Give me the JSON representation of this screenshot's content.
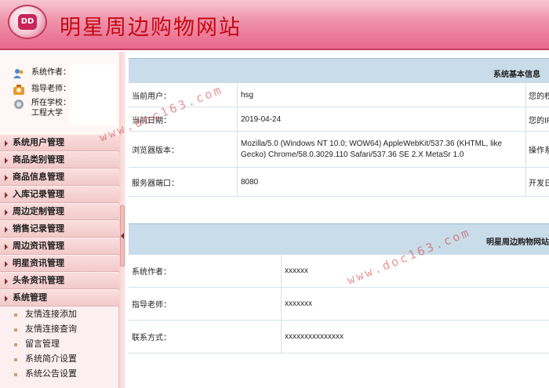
{
  "header": {
    "logo_text": "DD",
    "title": "明星周边购物网站"
  },
  "user_info": {
    "author_label": "系统作者：",
    "teacher_label": "指导老师：",
    "school_label": "所在学校：",
    "school_value_tail": "工程大学"
  },
  "sidebar": {
    "menu": [
      "系统用户管理",
      "商品类别管理",
      "商品信息管理",
      "入库记录管理",
      "周边定制管理",
      "销售记录管理",
      "周边资讯管理",
      "明星资讯管理",
      "头条资讯管理",
      "系统管理"
    ],
    "submenu": [
      "友情连接添加",
      "友情连接查询",
      "留言管理",
      "系统简介设置",
      "系统公告设置"
    ]
  },
  "system_info": {
    "title": "系统基本信息",
    "rows": [
      {
        "label": "当前用户：",
        "value": "hsg",
        "extra": "您的权"
      },
      {
        "label": "当前日期：",
        "value": "2019-04-24",
        "extra": "您的IP"
      },
      {
        "label": "浏览器版本：",
        "value": "Mozilla/5.0 (Windows NT 10.0; WOW64) AppleWebKit/537.36 (KHTML, like Gecko) Chrome/58.0.3029.110 Safari/537.36 SE 2.X MetaSr 1.0",
        "extra": "操作系"
      },
      {
        "label": "服务器端口：",
        "value": "8080",
        "extra": "开发日"
      }
    ]
  },
  "site_info": {
    "title": "明星周边购物网站",
    "rows": [
      {
        "label": "系统作者：",
        "value": "xxxxxx"
      },
      {
        "label": "指导老师：",
        "value": "xxxxxxx"
      },
      {
        "label": "联系方式：",
        "value": "xxxxxxxxxxxxxxx"
      }
    ]
  },
  "watermark": "www.doc163.com",
  "colors": {
    "header_pink": "#e9678c",
    "title_red": "#c40a14",
    "table_header_blue": "#c9dcea",
    "menu_pink": "#f2caca"
  }
}
